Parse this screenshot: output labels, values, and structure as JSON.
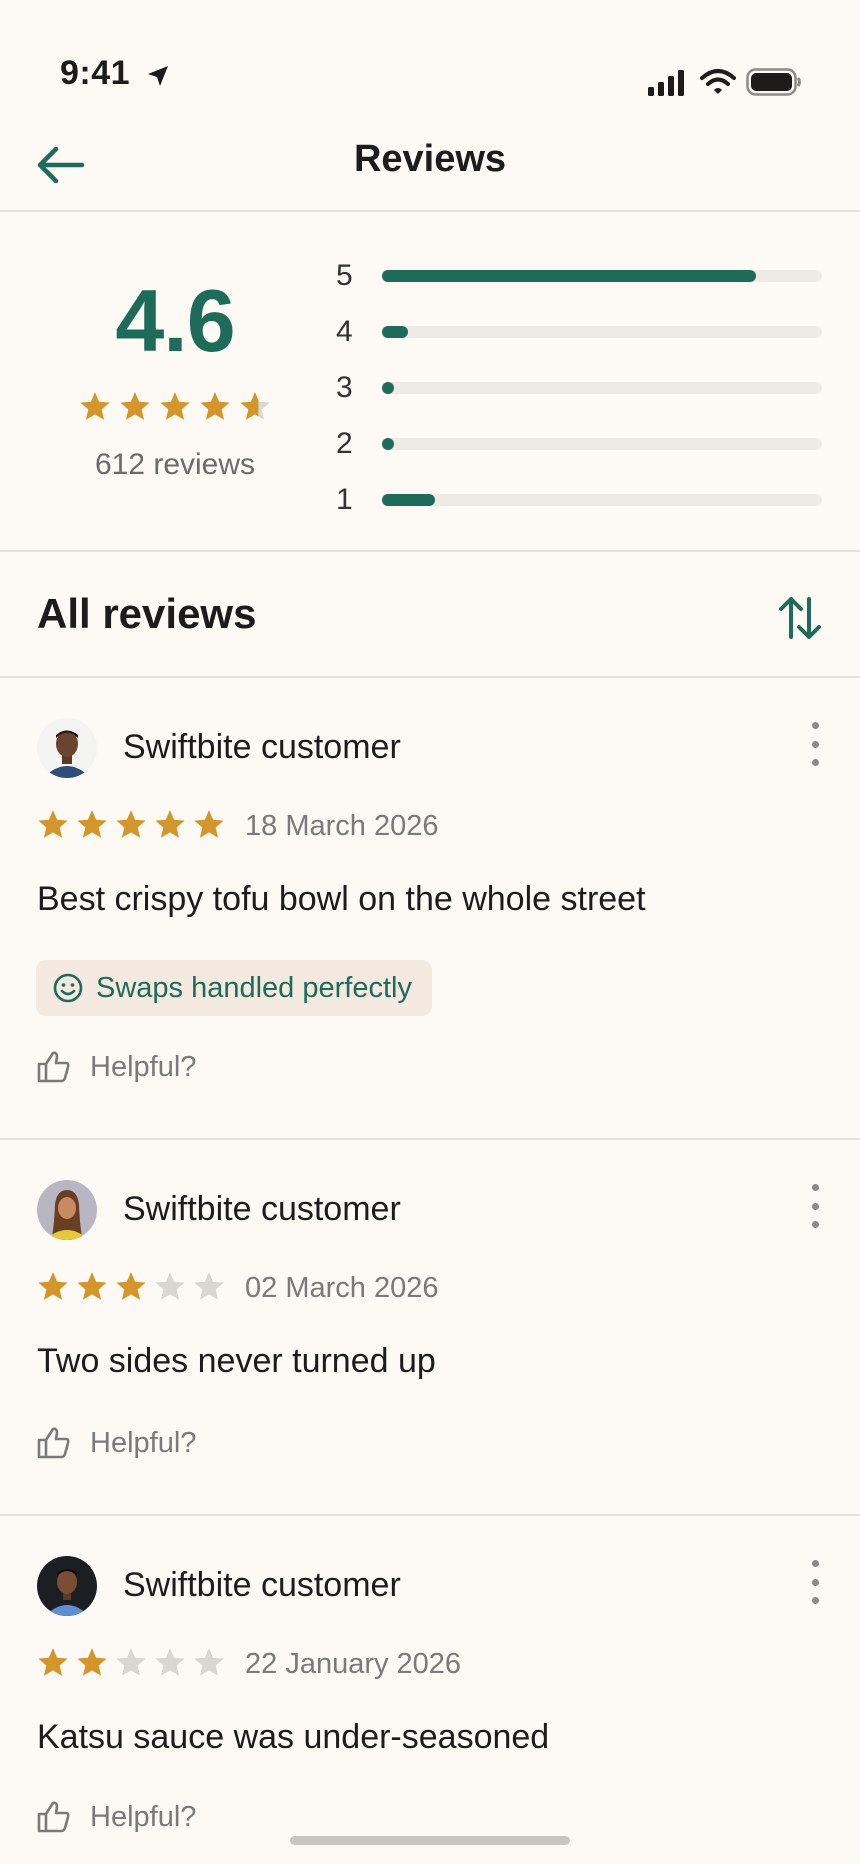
{
  "status_bar": {
    "time": "9:41"
  },
  "nav": {
    "title": "Reviews"
  },
  "summary": {
    "score": "4.6",
    "stars": 4.6,
    "count_label": "612 reviews",
    "breakdown": [
      {
        "label": "5",
        "fraction": 0.85
      },
      {
        "label": "4",
        "fraction": 0.06
      },
      {
        "label": "3",
        "fraction": 0.02
      },
      {
        "label": "2",
        "fraction": 0.02
      },
      {
        "label": "1",
        "fraction": 0.12
      }
    ]
  },
  "all_reviews": {
    "title": "All reviews"
  },
  "reviews": [
    {
      "name": "Swiftbite customer",
      "rating": 5,
      "date": "18 March 2026",
      "text": "Best crispy tofu bowl on the whole street",
      "tag": "Swaps handled perfectly",
      "helpful": "Helpful?"
    },
    {
      "name": "Swiftbite customer",
      "rating": 3,
      "date": "02 March 2026",
      "text": "Two sides never turned up",
      "helpful": "Helpful?"
    },
    {
      "name": "Swiftbite customer",
      "rating": 2,
      "date": "22 January 2026",
      "text": "Katsu sauce was under-seasoned",
      "helpful": "Helpful?"
    }
  ],
  "colors": {
    "accent": "#1f6b59",
    "star": "#d4952a",
    "star_empty": "#dad6d2",
    "background": "#fdfaf6"
  }
}
